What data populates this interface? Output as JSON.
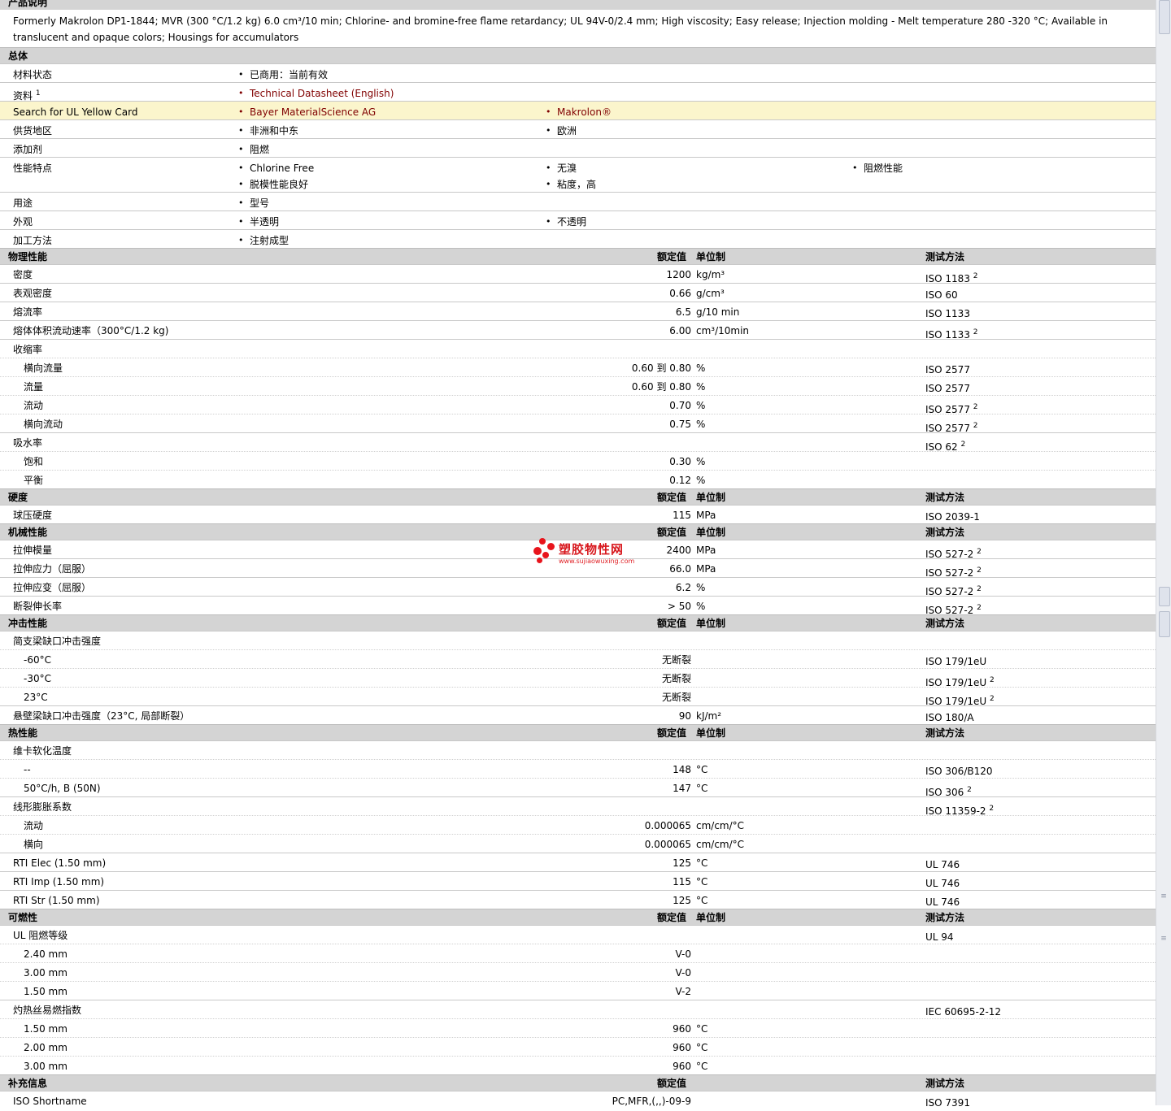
{
  "sections": {
    "product_desc": "产品说明",
    "general": "总体",
    "supplement": "补充信息"
  },
  "description": "Formerly Makrolon DP1-1844; MVR (300 °C/1.2 kg) 6.0 cm³/10 min; Chlorine- and bromine-free flame retardancy; UL 94V-0/2.4 mm; High viscosity; Easy release; Injection molding - Melt temperature 280 -320 °C; Available in translucent and opaque colors; Housings for accumulators",
  "headers": {
    "nominal": "额定值",
    "unit": "单位制",
    "test": "测试方法"
  },
  "general": {
    "material_status": {
      "label": "材料状态",
      "value": "已商用：当前有效"
    },
    "info": {
      "label": "资料",
      "sup": "1",
      "value": "Technical Datasheet (English)"
    },
    "ul_card": {
      "label": "Search for UL Yellow Card",
      "v1": "Bayer MaterialScience AG",
      "v2": "Makrolon®"
    },
    "supply": {
      "label": "供货地区",
      "v1": "非洲和中东",
      "v2": "欧洲"
    },
    "additive": {
      "label": "添加剂",
      "v1": "阻燃"
    },
    "features": {
      "label": "性能特点",
      "v1": "Chlorine Free",
      "v2": "无溴",
      "v3": "阻燃性能",
      "v4": "脱模性能良好",
      "v5": "粘度，高"
    },
    "uses": {
      "label": "用途",
      "v1": "型号"
    },
    "appearance": {
      "label": "外观",
      "v1": "半透明",
      "v2": "不透明"
    },
    "processing": {
      "label": "加工方法",
      "v1": "注射成型"
    }
  },
  "physical": {
    "title": "物理性能",
    "rows": [
      {
        "label": "密度",
        "nv": "1200",
        "unit": "kg/m³",
        "test": "ISO 1183",
        "sup": "2"
      },
      {
        "label": "表观密度",
        "nv": "0.66",
        "unit": "g/cm³",
        "test": "ISO 60",
        "sup": ""
      },
      {
        "label": "熔流率",
        "nv": "6.5",
        "unit": "g/10 min",
        "test": "ISO 1133",
        "sup": ""
      },
      {
        "label": "熔体体积流动速率（300°C/1.2 kg)",
        "nv": "6.00",
        "unit": "cm³/10min",
        "test": "ISO 1133",
        "sup": "2"
      },
      {
        "label": "收缩率",
        "nv": "",
        "unit": "",
        "test": "",
        "sup": ""
      },
      {
        "label": "横向流量",
        "nv": "0.60 到  0.80",
        "unit": "%",
        "test": "ISO 2577",
        "sup": ""
      },
      {
        "label": "流量",
        "nv": "0.60 到  0.80",
        "unit": "%",
        "test": "ISO 2577",
        "sup": ""
      },
      {
        "label": "流动",
        "nv": "0.70",
        "unit": "%",
        "test": "ISO 2577",
        "sup": "2"
      },
      {
        "label": "横向流动",
        "nv": "0.75",
        "unit": "%",
        "test": "ISO 2577",
        "sup": "2"
      },
      {
        "label": "吸水率",
        "nv": "",
        "unit": "",
        "test": "ISO 62",
        "sup": "2"
      },
      {
        "label": "饱和",
        "nv": "0.30",
        "unit": "%",
        "test": "",
        "sup": ""
      },
      {
        "label": "平衡",
        "nv": "0.12",
        "unit": "%",
        "test": "",
        "sup": ""
      }
    ]
  },
  "hardness": {
    "title": "硬度",
    "rows": [
      {
        "label": "球压硬度",
        "nv": "115",
        "unit": "MPa",
        "test": "ISO 2039-1",
        "sup": ""
      }
    ]
  },
  "mechanical": {
    "title": "机械性能",
    "rows": [
      {
        "label": "拉伸模量",
        "nv": "2400",
        "unit": "MPa",
        "test": "ISO 527-2",
        "sup": "2"
      },
      {
        "label": "拉伸应力（屈服）",
        "nv": "66.0",
        "unit": "MPa",
        "test": "ISO 527-2",
        "sup": "2"
      },
      {
        "label": "拉伸应变（屈服）",
        "nv": "6.2",
        "unit": "%",
        "test": "ISO 527-2",
        "sup": "2"
      },
      {
        "label": "断裂伸长率",
        "nv": "> 50",
        "unit": "%",
        "test": "ISO 527-2",
        "sup": "2"
      }
    ]
  },
  "impact": {
    "title": "冲击性能",
    "rows": [
      {
        "label": "简支梁缺口冲击强度",
        "nv": "",
        "unit": "",
        "test": "",
        "sup": ""
      },
      {
        "label": "-60°C",
        "nv": "无断裂",
        "unit": "",
        "test": "ISO 179/1eU",
        "sup": ""
      },
      {
        "label": "-30°C",
        "nv": "无断裂",
        "unit": "",
        "test": "ISO 179/1eU",
        "sup": "2"
      },
      {
        "label": "23°C",
        "nv": "无断裂",
        "unit": "",
        "test": "ISO 179/1eU",
        "sup": "2"
      },
      {
        "label": "悬壁梁缺口冲击强度（23°C, 局部断裂）",
        "nv": "90",
        "unit": "kJ/m²",
        "test": "ISO 180/A",
        "sup": ""
      }
    ]
  },
  "thermal": {
    "title": "热性能",
    "rows": [
      {
        "label": "维卡软化温度",
        "nv": "",
        "unit": "",
        "test": "",
        "sup": ""
      },
      {
        "label": "--",
        "nv": "148",
        "unit": "°C",
        "test": "ISO 306/B120",
        "sup": ""
      },
      {
        "label": "50°C/h, B (50N)",
        "nv": "147",
        "unit": "°C",
        "test": "ISO 306",
        "sup": "2"
      },
      {
        "label": "线形膨胀系数",
        "nv": "",
        "unit": "",
        "test": "ISO 11359-2",
        "sup": "2"
      },
      {
        "label": "流动",
        "nv": "0.000065",
        "unit": "cm/cm/°C",
        "test": "",
        "sup": ""
      },
      {
        "label": "横向",
        "nv": "0.000065",
        "unit": "cm/cm/°C",
        "test": "",
        "sup": ""
      },
      {
        "label": "RTI Elec (1.50 mm)",
        "nv": "125",
        "unit": "°C",
        "test": "UL 746",
        "sup": ""
      },
      {
        "label": "RTI Imp (1.50 mm)",
        "nv": "115",
        "unit": "°C",
        "test": "UL 746",
        "sup": ""
      },
      {
        "label": "RTI Str (1.50 mm)",
        "nv": "125",
        "unit": "°C",
        "test": "UL 746",
        "sup": ""
      }
    ]
  },
  "flammability": {
    "title": "可燃性",
    "rows": [
      {
        "label": "UL 阻燃等级",
        "nv": "",
        "unit": "",
        "test": "UL 94",
        "sup": ""
      },
      {
        "label": "2.40 mm",
        "nv": "V-0",
        "unit": "",
        "test": "",
        "sup": ""
      },
      {
        "label": "3.00 mm",
        "nv": "V-0",
        "unit": "",
        "test": "",
        "sup": ""
      },
      {
        "label": "1.50 mm",
        "nv": "V-2",
        "unit": "",
        "test": "",
        "sup": ""
      },
      {
        "label": "灼热丝易燃指数",
        "nv": "",
        "unit": "",
        "test": "IEC 60695-2-12",
        "sup": ""
      },
      {
        "label": "1.50 mm",
        "nv": "960",
        "unit": "°C",
        "test": "",
        "sup": ""
      },
      {
        "label": "2.00 mm",
        "nv": "960",
        "unit": "°C",
        "test": "",
        "sup": ""
      },
      {
        "label": "3.00 mm",
        "nv": "960",
        "unit": "°C",
        "test": "",
        "sup": ""
      }
    ]
  },
  "supplement": {
    "rows": [
      {
        "label": "ISO Shortname",
        "nv": "PC,MFR,(,,)-09-9",
        "unit": "",
        "test": "ISO 7391",
        "sup": ""
      }
    ]
  },
  "watermark": {
    "title": "塑胶物性网",
    "url": "www.sujiaowuxing.com"
  },
  "colors": {
    "link": "#800000",
    "highlight": "#fbf5cc",
    "section_bg": "#d4d4d4",
    "watermark": "#e8141c"
  }
}
